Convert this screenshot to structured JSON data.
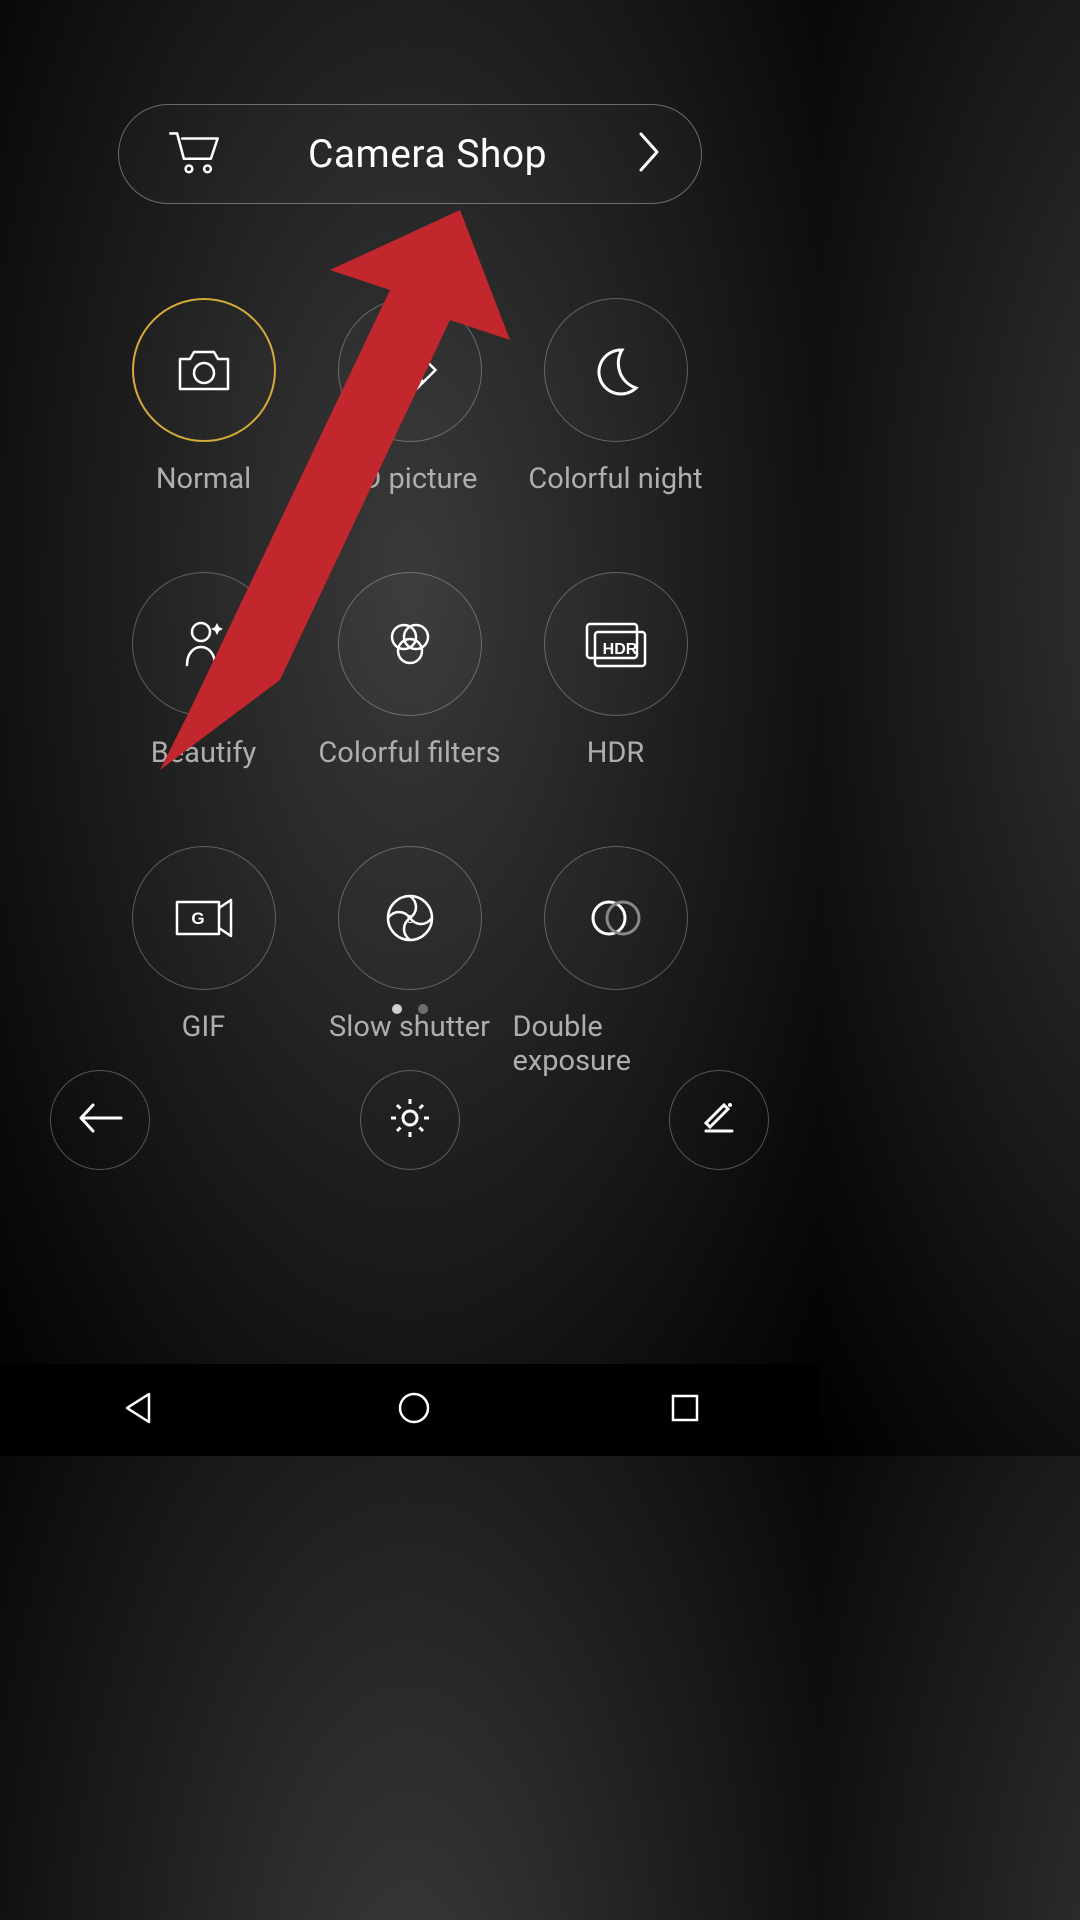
{
  "shop": {
    "label": "Camera Shop"
  },
  "modes": [
    {
      "id": "normal",
      "label": "Normal",
      "selected": true
    },
    {
      "id": "hd-picture",
      "label": "HD picture",
      "selected": false
    },
    {
      "id": "colorful-night",
      "label": "Colorful night",
      "selected": false
    },
    {
      "id": "beautify",
      "label": "Beautify",
      "selected": false
    },
    {
      "id": "colorful-filters",
      "label": "Colorful filters",
      "selected": false
    },
    {
      "id": "hdr",
      "label": "HDR",
      "selected": false
    },
    {
      "id": "gif",
      "label": "GIF",
      "selected": false
    },
    {
      "id": "slow-shutter",
      "label": "Slow shutter",
      "selected": false
    },
    {
      "id": "double-exposure",
      "label": "Double exposure",
      "selected": false
    }
  ],
  "pagination": {
    "pages": 2,
    "current": 1
  },
  "annotation": {
    "color": "#c1272d",
    "type": "arrow",
    "target": "shop-pill"
  }
}
